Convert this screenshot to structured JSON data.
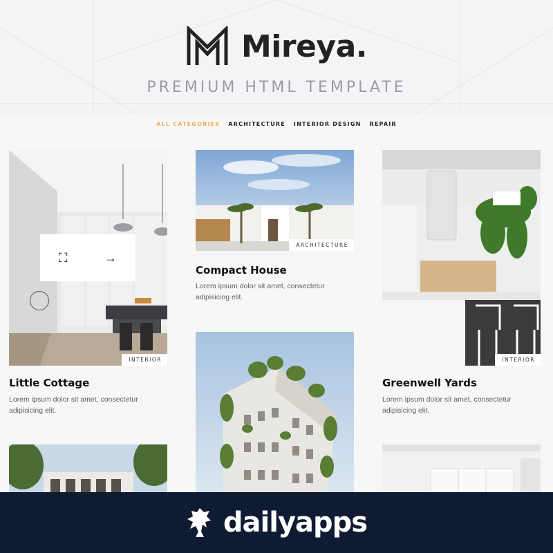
{
  "header": {
    "brand": "Mireya",
    "brand_dot": ".",
    "tagline": "PREMIUM HTML TEMPLATE"
  },
  "filters": [
    {
      "label": "ALL CATEGORIES",
      "active": true
    },
    {
      "label": "ARCHITECTURE",
      "active": false
    },
    {
      "label": "INTERIOR DESIGN",
      "active": false
    },
    {
      "label": "REPAIR",
      "active": false
    }
  ],
  "cards": [
    {
      "title": "Little Cottage",
      "tag": "INTERIOR",
      "desc": "Lorem ipsum dolor sit amet, consectetur adipisicing elit."
    },
    {
      "title": "Compact House",
      "tag": "ARCHITECTURE",
      "desc": "Lorem ipsum dolor sit amet, consectetur adipisicing elit."
    },
    {
      "title": "Greenwell Yards",
      "tag": "INTERIOR",
      "desc": "Lorem ipsum dolor sit amet, consectetur adipisicing elit."
    }
  ],
  "hover_icons": {
    "expand": "expand-icon",
    "arrow": "arrow-right-icon"
  },
  "banner": {
    "text": "dailyapps",
    "icon": "dailyapps-logo-icon"
  },
  "colors": {
    "accent": "#e8b357",
    "banner_bg": "#0f1b33",
    "text_dark": "#1c1c1e"
  }
}
